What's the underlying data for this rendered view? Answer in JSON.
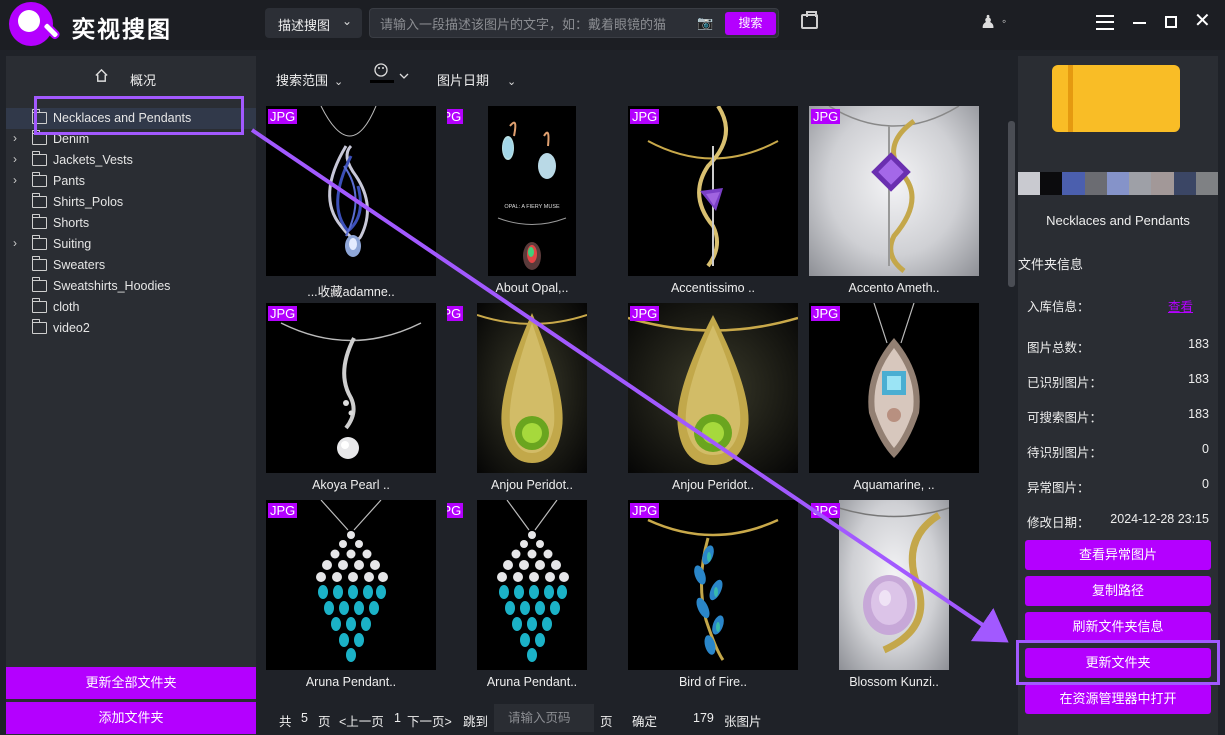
{
  "app": {
    "title": "奕视搜图"
  },
  "header": {
    "mode_label": "描述搜图",
    "search_placeholder": "请输入一段描述该图片的文字，如：戴着眼镜的猫",
    "search_button": "搜索"
  },
  "sidebar": {
    "overview_label": "概况",
    "folders": [
      {
        "label": "Necklaces and Pendants",
        "expandable": false,
        "selected": true
      },
      {
        "label": "Denim",
        "expandable": true
      },
      {
        "label": "Jackets_Vests",
        "expandable": true
      },
      {
        "label": "Pants",
        "expandable": true
      },
      {
        "label": "Shirts_Polos",
        "expandable": false
      },
      {
        "label": "Shorts",
        "expandable": false
      },
      {
        "label": "Suiting",
        "expandable": true
      },
      {
        "label": "Sweaters",
        "expandable": false
      },
      {
        "label": "Sweatshirts_Hoodies",
        "expandable": false
      },
      {
        "label": "cloth",
        "expandable": false
      },
      {
        "label": "video2",
        "expandable": false
      }
    ],
    "update_all_button": "更新全部文件夹",
    "add_folder_button": "添加文件夹"
  },
  "toolbar": {
    "scope_label": "搜索范围",
    "date_label": "图片日期"
  },
  "images": [
    {
      "badge": "JPG",
      "caption": "...收藏adamne.."
    },
    {
      "badge": "JPG",
      "caption": "About Opal,.."
    },
    {
      "badge": "JPG",
      "caption": "Accentissimo .."
    },
    {
      "badge": "JPG",
      "caption": "Accento Ameth.."
    },
    {
      "badge": "JPG",
      "caption": "Akoya Pearl .."
    },
    {
      "badge": "JPG",
      "caption": "Anjou Peridot.."
    },
    {
      "badge": "JPG",
      "caption": "Anjou Peridot.."
    },
    {
      "badge": "JPG",
      "caption": "Aquamarine, .."
    },
    {
      "badge": "JPG",
      "caption": "Aruna Pendant.."
    },
    {
      "badge": "JPG",
      "caption": "Aruna Pendant.."
    },
    {
      "badge": "JPG",
      "caption": "Bird of Fire.."
    },
    {
      "badge": "JPG",
      "caption": "Blossom Kunzi.."
    }
  ],
  "image_text": {
    "opal_poster": "OPAL: A FIERY MUSE"
  },
  "pager": {
    "total_prefix": "共",
    "total_pages": "5",
    "page_unit": "页",
    "prev": "<上一页",
    "current": "1",
    "next": "下一页>",
    "jump": "跳到",
    "input_placeholder": "请输入页码",
    "page_unit2": "页",
    "confirm": "确定",
    "image_count": "179",
    "count_unit": "张图片"
  },
  "details": {
    "folder_name": "Necklaces and Pendants",
    "section_title": "文件夹信息",
    "rows": [
      {
        "key": "入库信息：",
        "value": "查看"
      },
      {
        "key": "图片总数：",
        "value": "183"
      },
      {
        "key": "已识别图片：",
        "value": "183"
      },
      {
        "key": "可搜索图片：",
        "value": "183"
      },
      {
        "key": "待识别图片：",
        "value": "0"
      },
      {
        "key": "异常图片：",
        "value": "0"
      },
      {
        "key": "修改日期：",
        "value": "2024-12-28 23:15"
      }
    ],
    "buttons": [
      "查看异常图片",
      "复制路径",
      "刷新文件夹信息",
      "更新文件夹",
      "在资源管理器中打开"
    ],
    "palette": [
      "#c9cad0",
      "#0b0b0d",
      "#4b5fae",
      "#6b6c72",
      "#8593c9",
      "#9ea0a7",
      "#a29898",
      "#3b4665",
      "#7f8184"
    ]
  },
  "colors": {
    "accent": "#b400ff",
    "annotation": "#a259ff"
  }
}
